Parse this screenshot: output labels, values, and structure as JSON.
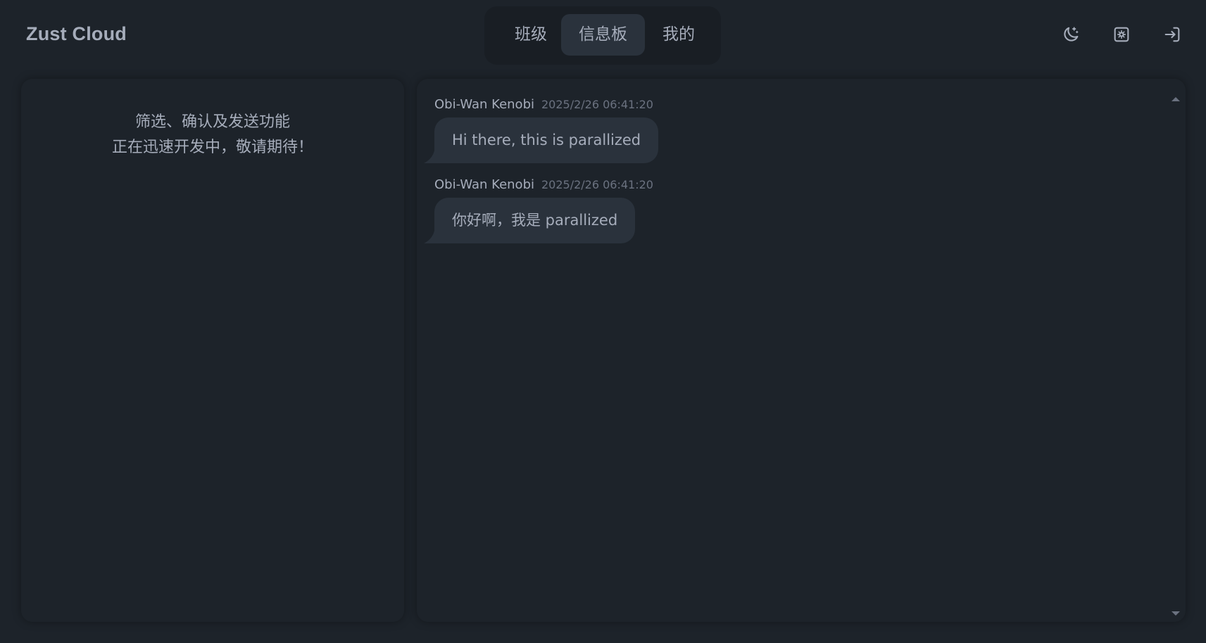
{
  "app": {
    "brand": "Zust Cloud"
  },
  "nav": {
    "tabs": [
      {
        "label": "班级",
        "active": false
      },
      {
        "label": "信息板",
        "active": true
      },
      {
        "label": "我的",
        "active": false
      }
    ],
    "icons": [
      "theme-moon-icon",
      "settings-icon",
      "logout-icon"
    ]
  },
  "left_panel": {
    "line1": "筛选、确认及发送功能",
    "line2": "正在迅速开发中，敬请期待！"
  },
  "messages": [
    {
      "author": "Obi-Wan Kenobi",
      "time": "2025/2/26 06:41:20",
      "text": "Hi there, this is parallized"
    },
    {
      "author": "Obi-Wan Kenobi",
      "time": "2025/2/26 06:41:20",
      "text": "你好啊，我是 parallized"
    }
  ],
  "colors": {
    "background": "#1d232a",
    "surface": "#2a323c",
    "tabs_bg": "#191e24",
    "text": "#a6adbb",
    "muted": "#6b7280"
  }
}
